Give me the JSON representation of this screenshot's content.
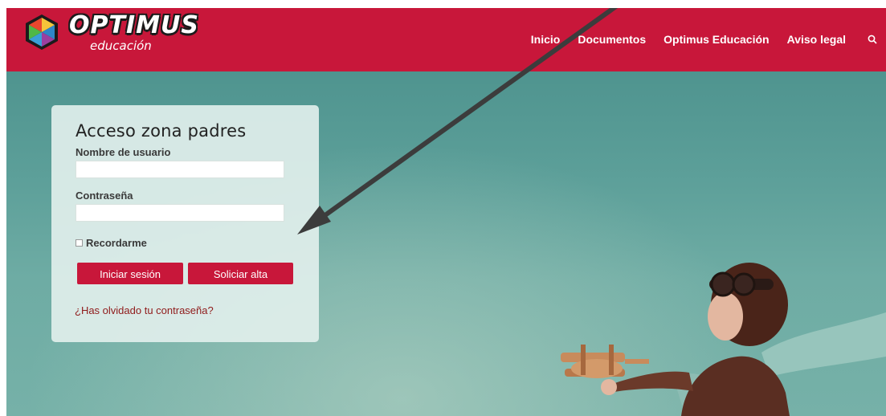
{
  "brand": {
    "name": "OPTIMUS",
    "sub": "educación",
    "colors": {
      "primary": "#c8173a",
      "dark": "#1b1b1b"
    }
  },
  "nav": {
    "items": [
      "Inicio",
      "Documentos",
      "Optimus Educación",
      "Aviso legal"
    ],
    "search_icon": "search-icon"
  },
  "login": {
    "title": "Acceso zona padres",
    "username_label": "Nombre de usuario",
    "username_value": "",
    "password_label": "Contraseña",
    "password_value": "",
    "remember_label": "Recordarme",
    "remember_checked": false,
    "login_button": "Iniciar sesión",
    "signup_button": "Soliciar alta",
    "forgot_link": "¿Has olvidado tu contraseña?"
  },
  "annotation": {
    "arrow_icon": "annotation-arrow-icon",
    "arrow_color": "#3c3c3c"
  }
}
